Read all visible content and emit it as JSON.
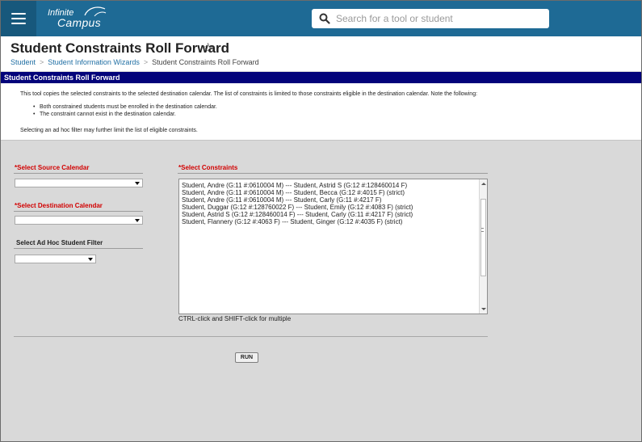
{
  "app": {
    "logo_line1": "Infinite",
    "logo_line2": "Campus",
    "menu_icon": "hamburger-menu-icon"
  },
  "search": {
    "placeholder": "Search for a tool or student",
    "icon": "search-icon"
  },
  "header": {
    "title": "Student Constraints Roll Forward",
    "favorite_icon": "star-outline-icon",
    "breadcrumbs": [
      "Student",
      "Student Information Wizards",
      "Student Constraints Roll Forward"
    ]
  },
  "band": {
    "title": "Student Constraints Roll Forward"
  },
  "description": {
    "intro": "This tool copies the selected constraints to the selected destination calendar. The list of constraints is limited to those constraints eligible in the destination calendar. Note the following:",
    "notes": [
      "Both constrained students must be enrolled in the destination calendar.",
      "The constraint cannot exist in the destination calendar."
    ],
    "footer": "Selecting an ad hoc filter may further limit the list of eligible constraints."
  },
  "form": {
    "source_calendar_label": "*Select Source Calendar",
    "source_calendar_value": "",
    "destination_calendar_label": "*Select Destination Calendar",
    "destination_calendar_value": "",
    "adhoc_filter_label": "Select Ad Hoc Student Filter",
    "adhoc_filter_value": "",
    "constraints_label": "*Select Constraints",
    "constraints": [
      "Student, Andre (G:11 #:0610004 M) --- Student, Astrid S (G:12 #:128460014 F)",
      "Student, Andre (G:11 #:0610004 M) --- Student, Becca (G:12 #:4015 F) (strict)",
      "Student, Andre (G:11 #:0610004 M) --- Student, Carly (G:11 #:4217 F)",
      "Student, Duggar (G:12 #:128760022 F) --- Student, Emily (G:12 #:4083 F) (strict)",
      "Student, Astrid S (G:12 #:128460014 F) --- Student, Carly (G:11 #:4217 F) (strict)",
      "Student, Flannery (G:12 #:4063 F) --- Student, Ginger (G:12 #:4035 F) (strict)"
    ],
    "multi_select_hint": "CTRL-click and SHIFT-click for multiple",
    "run_label": "RUN"
  },
  "colors": {
    "topbar": "#1e6a95",
    "band": "#03037a",
    "required_label": "#d20000",
    "link": "#1f6ea3"
  }
}
